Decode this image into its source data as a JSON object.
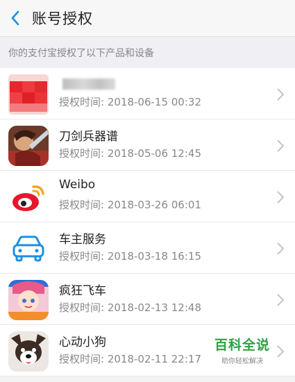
{
  "header": {
    "title": "账号授权",
    "back_icon": "chevron-left-icon",
    "accent": "#1a8fe3"
  },
  "section": {
    "label": "你的支付宝授权了以下产品和设备"
  },
  "items": [
    {
      "name": "",
      "time": "授权时间: 2018-06-15 00:32",
      "icon": "blurred-app-icon"
    },
    {
      "name": "刀剑兵器谱",
      "time": "授权时间: 2018-05-06 12:45",
      "icon": "game-character-icon"
    },
    {
      "name": "Weibo",
      "time": "授权时间: 2018-03-26 06:01",
      "icon": "weibo-icon"
    },
    {
      "name": "车主服务",
      "time": "授权时间: 2018-03-18 16:15",
      "icon": "car-icon"
    },
    {
      "name": "疯狂飞车",
      "time": "授权时间: 2018-02-13 12:48",
      "icon": "racing-game-icon"
    },
    {
      "name": "心动小狗",
      "time": "授权时间: 2018-02-11 22:17",
      "icon": "dog-icon"
    }
  ],
  "watermark": {
    "title": "百科全说",
    "subtitle": "助你轻松解决",
    "color": "#2ea043"
  }
}
